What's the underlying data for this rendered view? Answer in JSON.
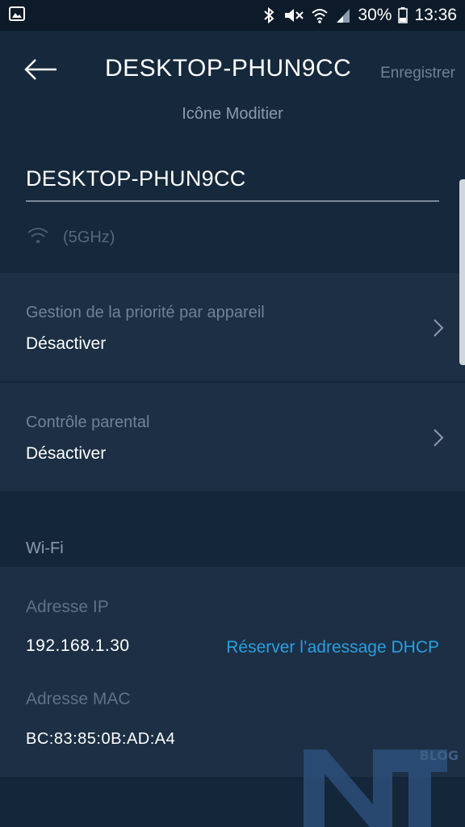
{
  "status_bar": {
    "battery": "30%",
    "time": "13:36",
    "icons": [
      "image-icon",
      "bluetooth-icon",
      "mute-icon",
      "wifi-icon",
      "signal-icon",
      "battery-icon"
    ]
  },
  "header": {
    "title": "DESKTOP-PHUN9CC",
    "save_label": "Enregistrer",
    "edit_icon_label": "Icône Moditier"
  },
  "device": {
    "name_value": "DESKTOP-PHUN9CC",
    "band": "(5GHz)"
  },
  "settings": [
    {
      "label": "Gestion de la priorité par appareil",
      "value": "Désactiver"
    },
    {
      "label": "Contrôle parental",
      "value": "Désactiver"
    }
  ],
  "wifi_section": {
    "title": "Wi-Fi",
    "ip_label": "Adresse IP",
    "ip_value": "192.168.1.30",
    "dhcp_link": "Réserver l’adressage DHCP",
    "mac_label": "Adresse MAC",
    "mac_value": "BC:83:85:0B:AD:A4"
  },
  "watermark": {
    "text": "BLOG",
    "logo_letters": "NT"
  },
  "colors": {
    "background": "#14263a",
    "panel": "#1c2f44",
    "link": "#2a9ee0",
    "muted": "#6f8296"
  }
}
